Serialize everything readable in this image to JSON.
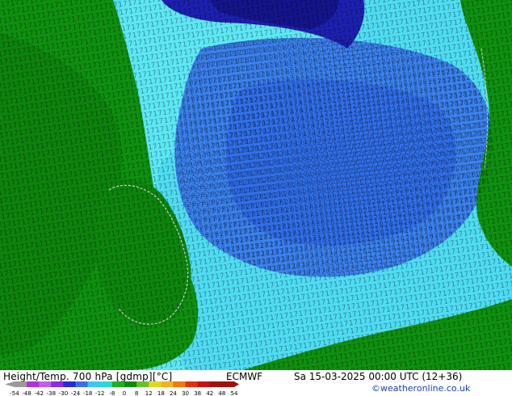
{
  "footer": {
    "title": "Height/Temp. 700 hPa [gdmp][°C]",
    "model": "ECMWF",
    "valid": "Sa 15-03-2025 00:00 UTC (12+36)",
    "credit": "©weatheronline.co.uk"
  },
  "scale": {
    "labels": [
      "-54",
      "-48",
      "-42",
      "-38",
      "-30",
      "-24",
      "-18",
      "-12",
      "-8",
      "0",
      "8",
      "12",
      "18",
      "24",
      "30",
      "38",
      "42",
      "48",
      "54"
    ],
    "colors": [
      "#9a9a9a",
      "#b030d8",
      "#c060e8",
      "#8a2be2",
      "#2a2ad8",
      "#3a6ef0",
      "#39c8f0",
      "#2ad8d8",
      "#22b022",
      "#0c8a0c",
      "#6cbf2a",
      "#dcd826",
      "#f0b418",
      "#f07a10",
      "#e03010",
      "#c81010",
      "#a01010",
      "#a01010"
    ]
  },
  "map": {
    "legend_colors": {
      "light_cyan": "#5ee8f4",
      "cyan": "#37c8f2",
      "blue": "#3b82f0",
      "mid_blue": "#2b52e0",
      "dark_blue": "#1a1aa8",
      "green": "#0f8f0f",
      "dark_green": "#0b700b"
    }
  }
}
